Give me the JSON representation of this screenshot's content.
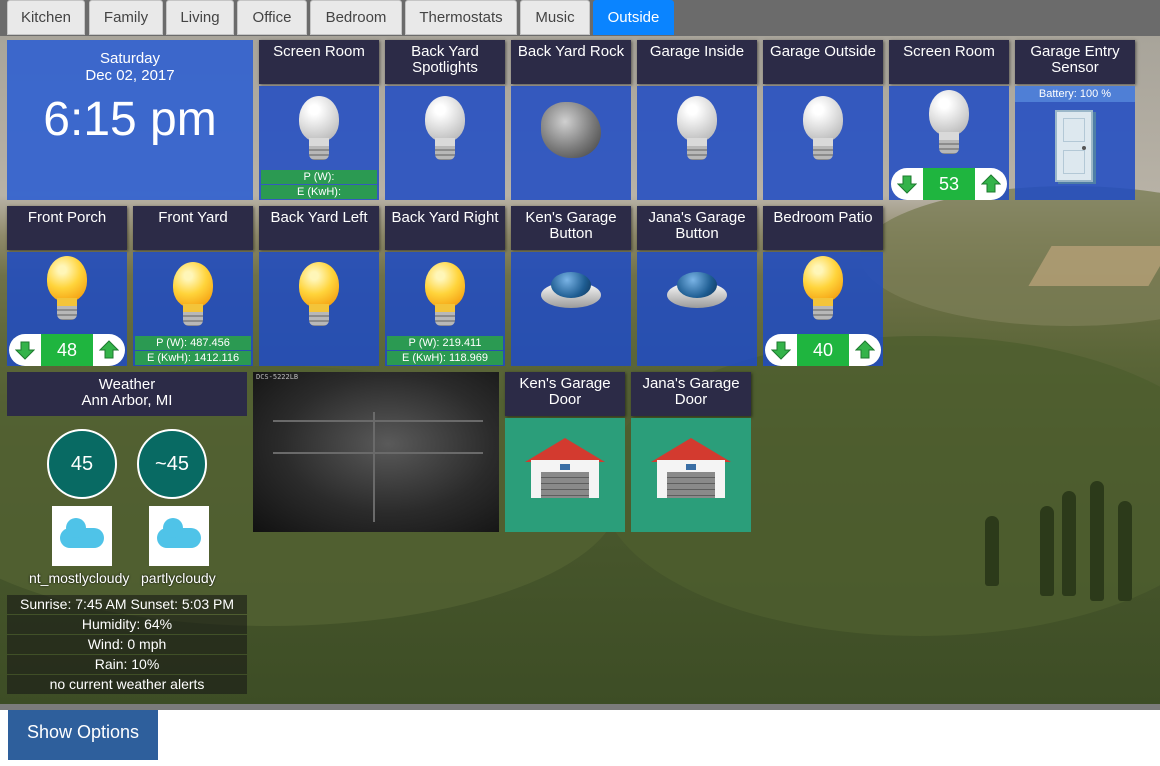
{
  "tabs": [
    "Kitchen",
    "Family",
    "Living",
    "Office",
    "Bedroom",
    "Thermostats",
    "Music",
    "Outside"
  ],
  "active_tab": "Outside",
  "clock": {
    "day": "Saturday",
    "date": "Dec 02, 2017",
    "time": "6:15 pm"
  },
  "tiles": {
    "screen_room_1": {
      "title": "Screen Room",
      "power": "P (W):",
      "energy": "E (KwH):"
    },
    "back_yard_spotlights": {
      "title": "Back Yard Spotlights"
    },
    "back_yard_rock": {
      "title": "Back Yard Rock"
    },
    "garage_inside": {
      "title": "Garage Inside"
    },
    "garage_outside": {
      "title": "Garage Outside"
    },
    "screen_room_2": {
      "title": "Screen Room",
      "level": "53"
    },
    "garage_entry_sensor": {
      "title": "Garage Entry Sensor",
      "battery": "Battery: 100 %"
    },
    "front_porch": {
      "title": "Front Porch",
      "level": "48"
    },
    "front_yard": {
      "title": "Front Yard",
      "power": "P (W): 487.456",
      "energy": "E (KwH): 1412.116"
    },
    "back_yard_left": {
      "title": "Back Yard Left"
    },
    "back_yard_right": {
      "title": "Back Yard Right",
      "power": "P (W): 219.411",
      "energy": "E (KwH): 118.969"
    },
    "kens_garage_button": {
      "title": "Ken's Garage Button"
    },
    "janas_garage_button": {
      "title": "Jana's Garage Button"
    },
    "bedroom_patio": {
      "title": "Bedroom Patio",
      "level": "40"
    },
    "kens_garage_door": {
      "title": "Ken's Garage Door"
    },
    "janas_garage_door": {
      "title": "Jana's Garage Door"
    }
  },
  "weather": {
    "title": "Weather",
    "location": "Ann Arbor, MI",
    "temp": "45",
    "feels_like": "~45",
    "icon_now": "nt_mostlycloudy",
    "icon_forecast": "partlycloudy",
    "sun": "Sunrise: 7:45 AM Sunset: 5:03 PM",
    "humidity": "Humidity: 64%",
    "wind": "Wind: 0 mph",
    "rain": "Rain: 10%",
    "alerts": "no current weather alerts"
  },
  "camera": {
    "label": "DCS-5222LB"
  },
  "footer": {
    "show_options": "Show Options"
  },
  "colors": {
    "tile_head": "#2c2b47",
    "tile_body": "#204cc4",
    "active_tab": "#0a84ff",
    "dimmer_green": "#1fb53f",
    "garage_bg": "#2b9e7a"
  }
}
